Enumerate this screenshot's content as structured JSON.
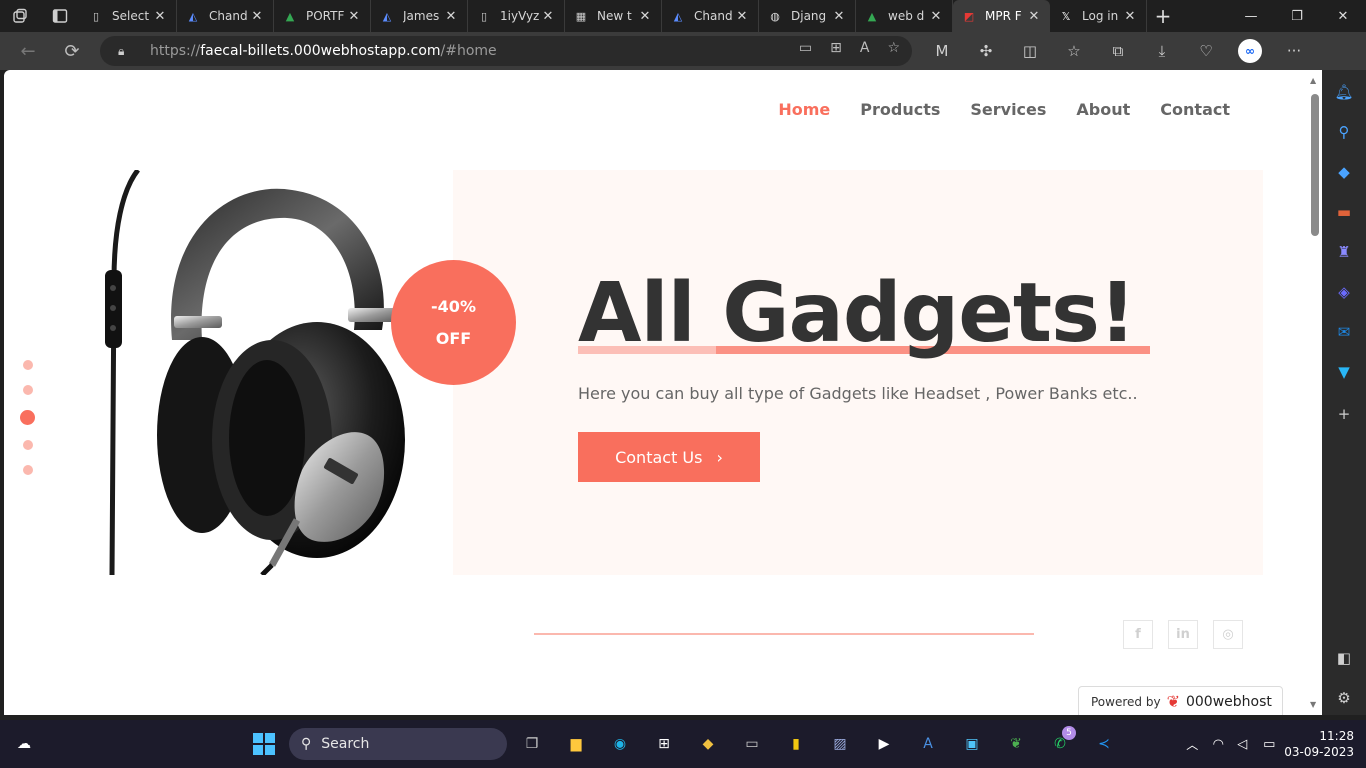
{
  "tabs": [
    {
      "title": "Select",
      "icon": "page-icon"
    },
    {
      "title": "Chand",
      "icon": "logo-icon"
    },
    {
      "title": "PORTF",
      "icon": "drive-icon"
    },
    {
      "title": "James",
      "icon": "logo-icon"
    },
    {
      "title": "1iyVyz",
      "icon": "page-icon"
    },
    {
      "title": "New t",
      "icon": "newtab-icon"
    },
    {
      "title": "Chand",
      "icon": "logo-icon"
    },
    {
      "title": "Djang",
      "icon": "github-icon"
    },
    {
      "title": "web d",
      "icon": "drive-icon"
    },
    {
      "title": "MPR F",
      "icon": "site-icon"
    },
    {
      "title": "Log in",
      "icon": "x-logo-icon"
    }
  ],
  "address": {
    "protocol": "https://",
    "host": "faecal-billets.000webhostapp.com",
    "path": "/#home"
  },
  "site": {
    "nav": [
      "Home",
      "Products",
      "Services",
      "About",
      "Contact"
    ],
    "badge_line1": "-40%",
    "badge_line2": "OFF",
    "headline": "All Gadgets!",
    "subtitle": "Here you can buy all type of Gadgets like Headset , Power Banks etc..",
    "cta_label": "Contact Us",
    "cta_arrow": "›",
    "socials": [
      "f",
      "in",
      "◎"
    ],
    "powered_label": "Powered by",
    "powered_brand": "000webhost",
    "accent_color": "#f96f5d"
  },
  "taskbar": {
    "search_placeholder": "Search",
    "time": "11:28",
    "date": "03-09-2023",
    "whatsapp_badge": "5"
  }
}
